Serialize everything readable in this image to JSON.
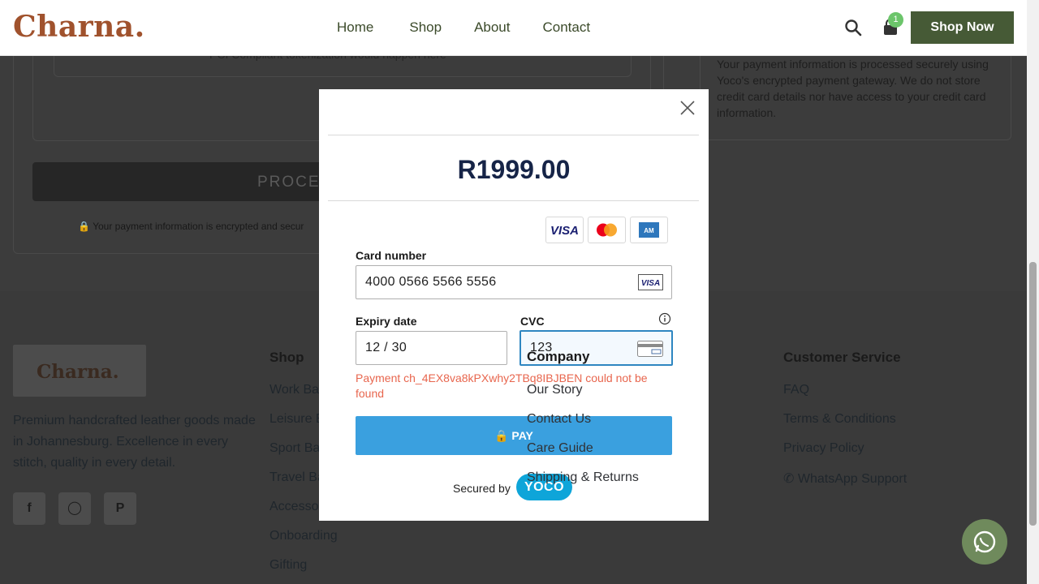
{
  "header": {
    "logo": "Charna.",
    "nav": [
      "Home",
      "Shop",
      "About",
      "Contact"
    ],
    "cart_count": "1",
    "shop_now": "Shop Now"
  },
  "background": {
    "pci_note": "PCI Compliant tokenization would happen here",
    "process_label": "PROCES",
    "encrypted_note": "Your payment information is encrypted and secur",
    "secure_text": "Your payment information is processed securely using Yoco's encrypted payment gateway. We do not store credit card details nor have access to your credit card information."
  },
  "footer": {
    "logo": "Charna.",
    "description": "Premium handcrafted leather goods made in Johannesburg. Excellence in every stitch, quality in every detail.",
    "social": [
      "facebook",
      "instagram",
      "pinterest"
    ],
    "shop_heading": "Shop",
    "shop_links": [
      "Work Bags",
      "Leisure Bags",
      "Sport Bags",
      "Travel Bags",
      "Accessories",
      "Onboarding",
      "Gifting"
    ],
    "company_heading": "Company",
    "company_links": [
      "Our Story",
      "Contact Us",
      "Care Guide",
      "Shipping & Returns"
    ],
    "service_heading": "Customer Service",
    "service_links": [
      "FAQ",
      "Terms & Conditions",
      "Privacy Policy",
      "WhatsApp Support"
    ]
  },
  "modal": {
    "amount": "R1999.00",
    "card_number_label": "Card number",
    "card_number": "4000 0566 5566 5556",
    "expiry_label": "Expiry date",
    "expiry": "12 / 30",
    "cvc_label": "CVC",
    "cvc": "123",
    "error": "Payment ch_4EX8va8kPXwhy2TBq8IBJBEN could not be found",
    "pay_label": "PAY",
    "secured_by": "Secured by",
    "provider": "YOCO",
    "card_brands": [
      "VISA",
      "Mastercard",
      "American Express"
    ]
  },
  "colors": {
    "brand": "#a0522d",
    "primary_green": "#465a36",
    "pay_blue": "#3aa0df",
    "error": "#e8664e",
    "yoco": "#0ea5d9"
  }
}
